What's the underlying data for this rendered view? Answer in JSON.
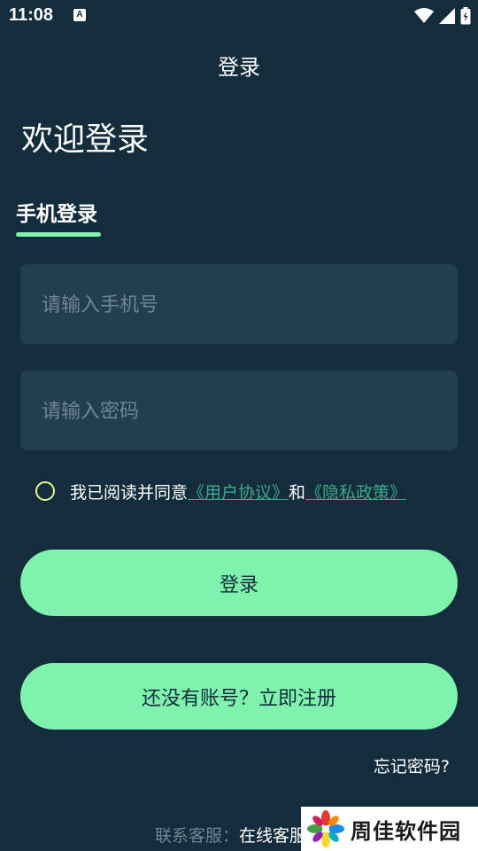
{
  "status_bar": {
    "time": "11:08",
    "notification_icon_letter": "A",
    "icons": [
      "wifi-icon",
      "signal-icon",
      "battery-icon"
    ]
  },
  "header": {
    "title": "登录"
  },
  "welcome": "欢迎登录",
  "tab": {
    "label": "手机登录"
  },
  "form": {
    "phone_placeholder": "请输入手机号",
    "phone_value": "",
    "password_placeholder": "请输入密码",
    "password_value": ""
  },
  "agreement": {
    "prefix": "我已阅读并同意",
    "user_agreement": "《用户协议》",
    "and": "和",
    "privacy_policy": "《隐私政策》"
  },
  "buttons": {
    "login": "登录",
    "register": "还没有账号？立即注册"
  },
  "forgot_password": "忘记密码?",
  "contact": {
    "label": "联系客服：",
    "value": "在线客服"
  },
  "watermark": {
    "text": "周佳软件园"
  },
  "colors": {
    "background": "#132d3d",
    "input_background": "#213f4f",
    "accent": "#7ff2ad",
    "link": "#3fa88a",
    "checkbox_border": "#e8f58a",
    "placeholder": "#6f8592"
  }
}
